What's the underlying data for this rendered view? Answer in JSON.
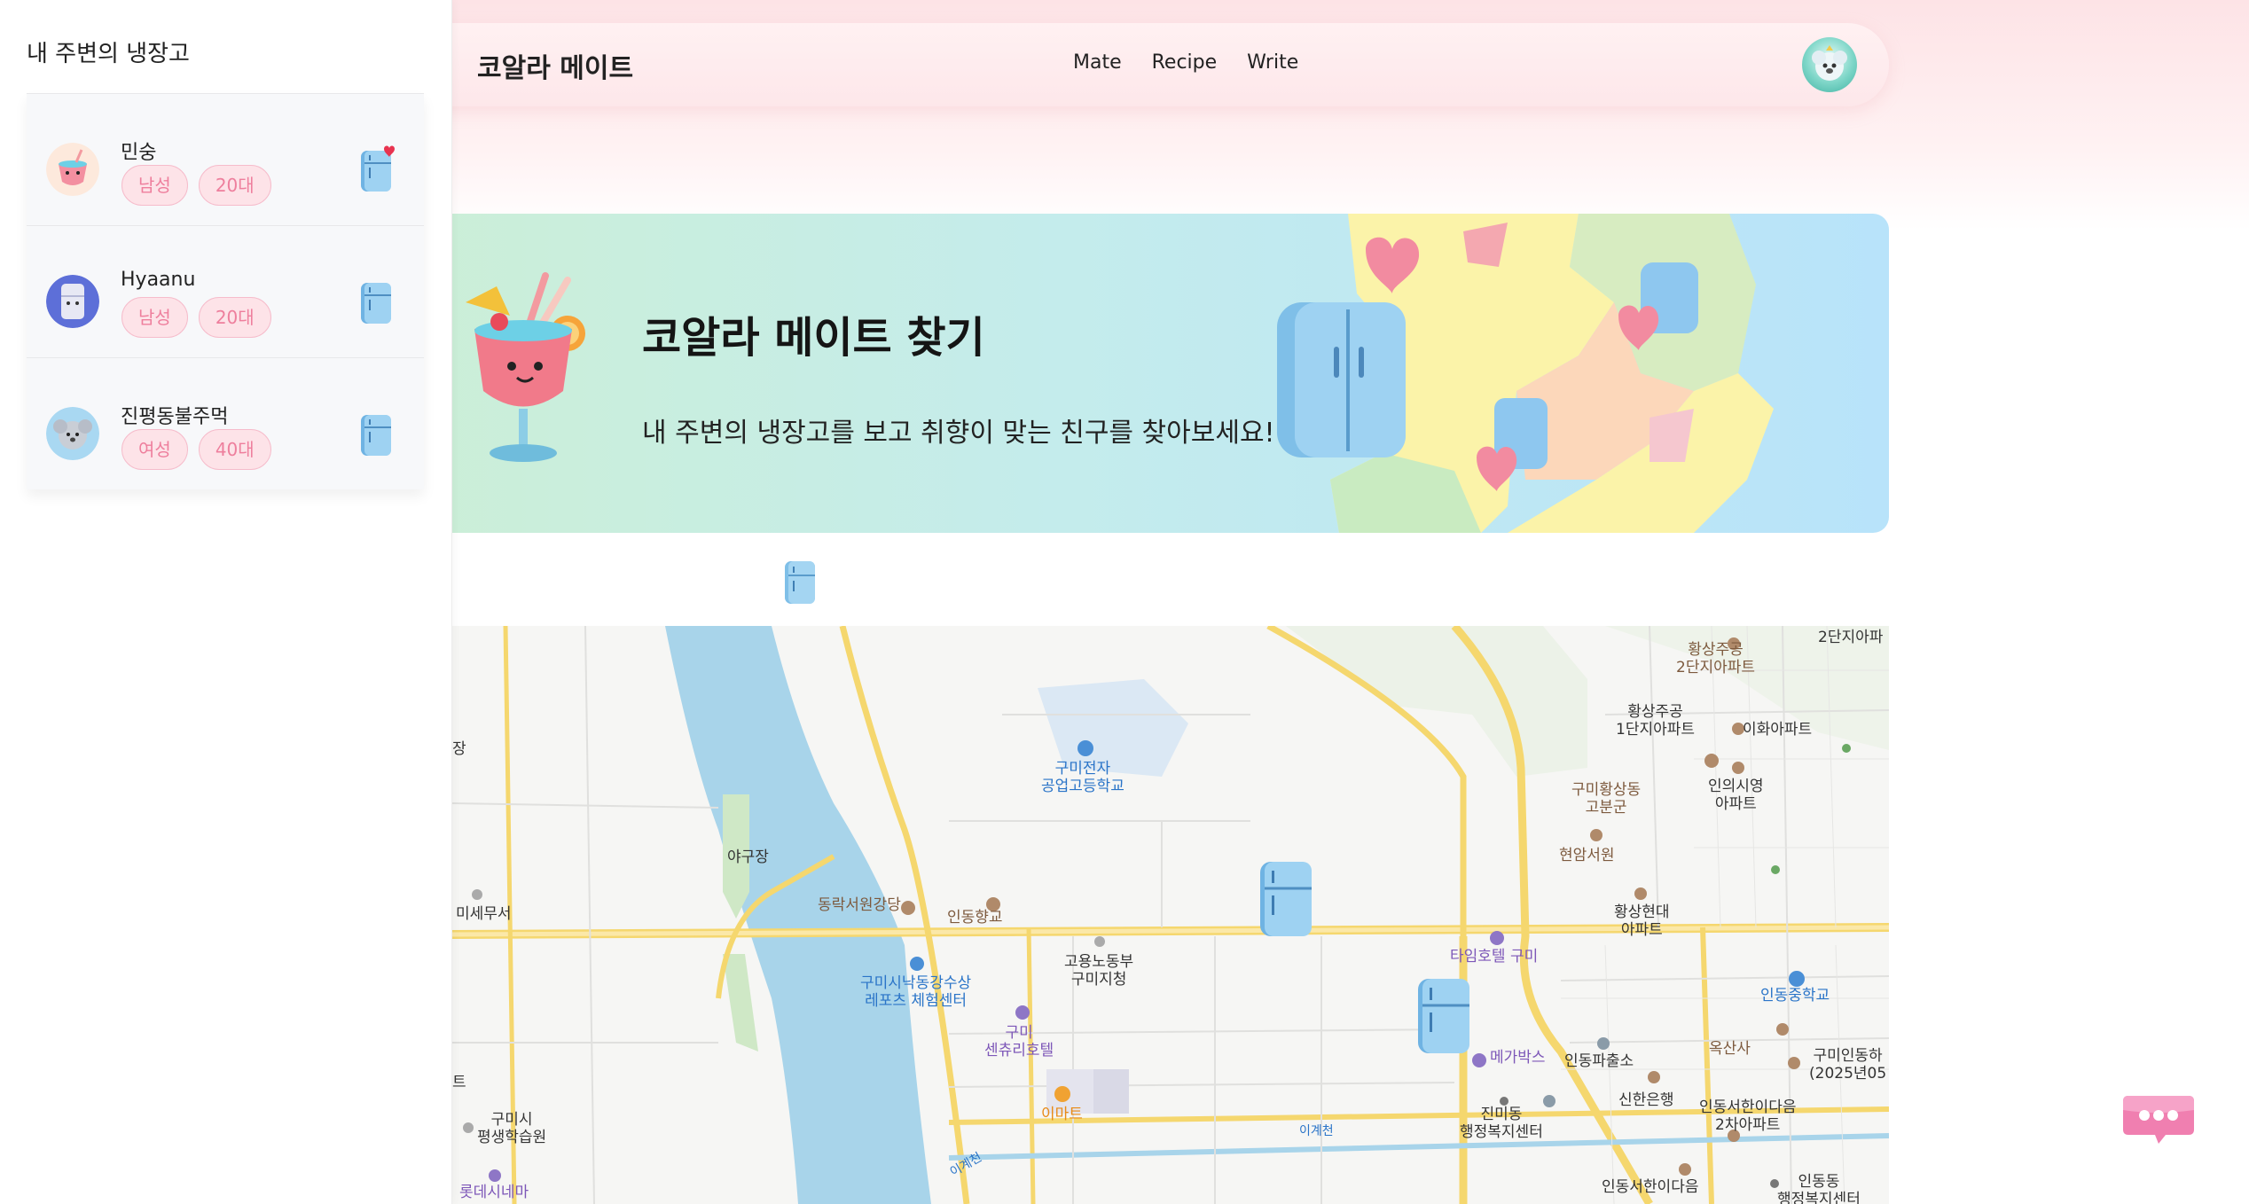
{
  "sidebar": {
    "title": "내 주변의 냉장고",
    "items": [
      {
        "name": "민숭",
        "tags": [
          "남성",
          "20대"
        ],
        "liked": true
      },
      {
        "name": "Hyaanu",
        "tags": [
          "남성",
          "20대"
        ],
        "liked": false
      },
      {
        "name": "진평동불주먹",
        "tags": [
          "여성",
          "40대"
        ],
        "liked": false
      }
    ]
  },
  "header": {
    "logo": "코알라 메이트",
    "nav": [
      "Mate",
      "Recipe",
      "Write"
    ]
  },
  "banner": {
    "title": "코알라 메이트 찾기",
    "subtitle": "내 주변의 냉장고를 보고 취향이 맞는 친구를 찾아보세요!"
  },
  "map": {
    "labels": {
      "l1": "황상주공\n2단지아파트",
      "l2": "2단지아파",
      "l3": "황상주공\n1단지아파트",
      "l4": "이화아파트",
      "l5": "구미황상동\n고분군",
      "l6": "인의시영\n아파트",
      "l7": "현암서원",
      "l8": "구미전자\n공업고등학교",
      "l9": "야구장",
      "l10": "동락서원강당",
      "l11": "인동향교",
      "l12": "미세무서",
      "l13": "고용노동부\n구미지청",
      "l14": "구미시낙동강수상\n레포츠 체험센터",
      "l15": "타임호텔 구미",
      "l16": "황상현대\n아파트",
      "l17": "인동중학교",
      "l18": "구미\n센츄리호텔",
      "l19": "이마트",
      "l20": "메가박스",
      "l21": "인동파출소",
      "l22": "옥산사",
      "l23": "구미인동하\n(2025년05",
      "l24": "신한은행",
      "l25": "진미동\n행정복지센터",
      "l26": "인동서한이다음\n2차아파트",
      "l27": "구미시\n평생학습원",
      "l28": "롯데시네마",
      "l29": "이계천",
      "l30": "이계천",
      "l31": "인동서한이다음",
      "l32": "인동동\n행정복지센터",
      "l33": "장",
      "l34": "트"
    }
  },
  "colors": {
    "accent_pink": "#ee7f9d",
    "tag_bg": "#fde3e8",
    "banner_green": "#ccefd6",
    "banner_blue": "#b8e3fa",
    "river": "#a8d4ea",
    "road_yellow": "#f5d76e"
  },
  "icons": {
    "fridge": "fridge-icon",
    "chat": "chat-bubble-icon",
    "heart": "heart-icon"
  }
}
